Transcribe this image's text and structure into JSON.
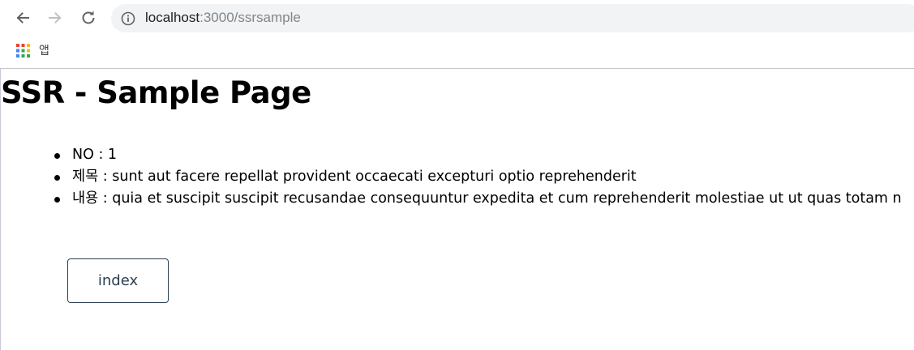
{
  "browser": {
    "url_host": "localhost",
    "url_path": ":3000/ssrsample",
    "bookmarks": {
      "apps_label": "앱"
    }
  },
  "page": {
    "title": "SSR - Sample Page",
    "details": [
      {
        "label": "NO",
        "separator": " : ",
        "value": "1"
      },
      {
        "label": "제목",
        "separator": " : ",
        "value": "sunt aut facere repellat provident occaecati excepturi optio reprehenderit"
      },
      {
        "label": "내용",
        "separator": " : ",
        "value": "quia et suscipit suscipit recusandae consequuntur expedita et cum reprehenderit molestiae ut ut quas totam n"
      }
    ],
    "index_button_label": "index"
  },
  "icons": {
    "back": "arrow-back-icon",
    "forward": "arrow-forward-icon",
    "reload": "reload-icon",
    "info": "info-icon",
    "apps": "apps-grid-icon"
  },
  "colors": {
    "omnibox_bg": "#f1f3f4",
    "button_border": "#2c3e50"
  }
}
